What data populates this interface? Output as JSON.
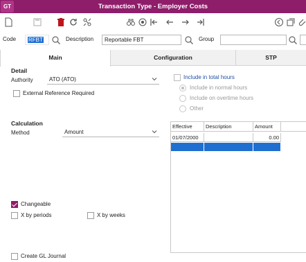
{
  "window": {
    "logo": "GT",
    "title": "Transaction Type - Employer Costs"
  },
  "toolbar": {
    "icons": [
      "new-icon",
      "save-icon",
      "delete-icon",
      "refresh-icon",
      "settings-icon",
      "binoculars-icon",
      "view-icon",
      "first-icon",
      "prev-icon",
      "next-icon",
      "last-icon",
      "back-icon",
      "copy-icon",
      "attach-icon"
    ],
    "accent": "#8e1d6a"
  },
  "header": {
    "code_label": "Code",
    "code_value": "RFBT",
    "description_label": "Description",
    "description_value": "Reportable FBT",
    "group_label": "Group",
    "group_value": ""
  },
  "tabs": [
    {
      "label": "Main",
      "active": true
    },
    {
      "label": "Configuration",
      "active": false
    },
    {
      "label": "STP",
      "active": false
    }
  ],
  "detail": {
    "heading": "Detail",
    "authority_label": "Authority",
    "authority_value": "ATO (ATO)",
    "external_ref_label": "External Reference Required",
    "external_ref_checked": false
  },
  "hours": {
    "include_total_label": "Include in total hours",
    "include_total_checked": false,
    "options": [
      "Include in normal hours",
      "Include on overtime hours",
      "Other"
    ],
    "selected": "Include in normal hours"
  },
  "calculation": {
    "heading": "Calculation",
    "method_label": "Method",
    "method_value": "Amount"
  },
  "table": {
    "columns": [
      "Effective",
      "Description",
      "Amount"
    ],
    "rows": [
      {
        "effective": "01/07/2000",
        "description": "",
        "amount": "0.00"
      },
      {
        "effective": "",
        "description": "",
        "amount": ""
      }
    ],
    "selection_color": "#1f6fd1"
  },
  "options": {
    "changeable_label": "Changeable",
    "changeable_checked": true,
    "x_by_periods_label": "X by periods",
    "x_by_periods_checked": false,
    "x_by_weeks_label": "X by weeks",
    "x_by_weeks_checked": false,
    "create_gl_label": "Create GL Journal",
    "create_gl_checked": false
  }
}
